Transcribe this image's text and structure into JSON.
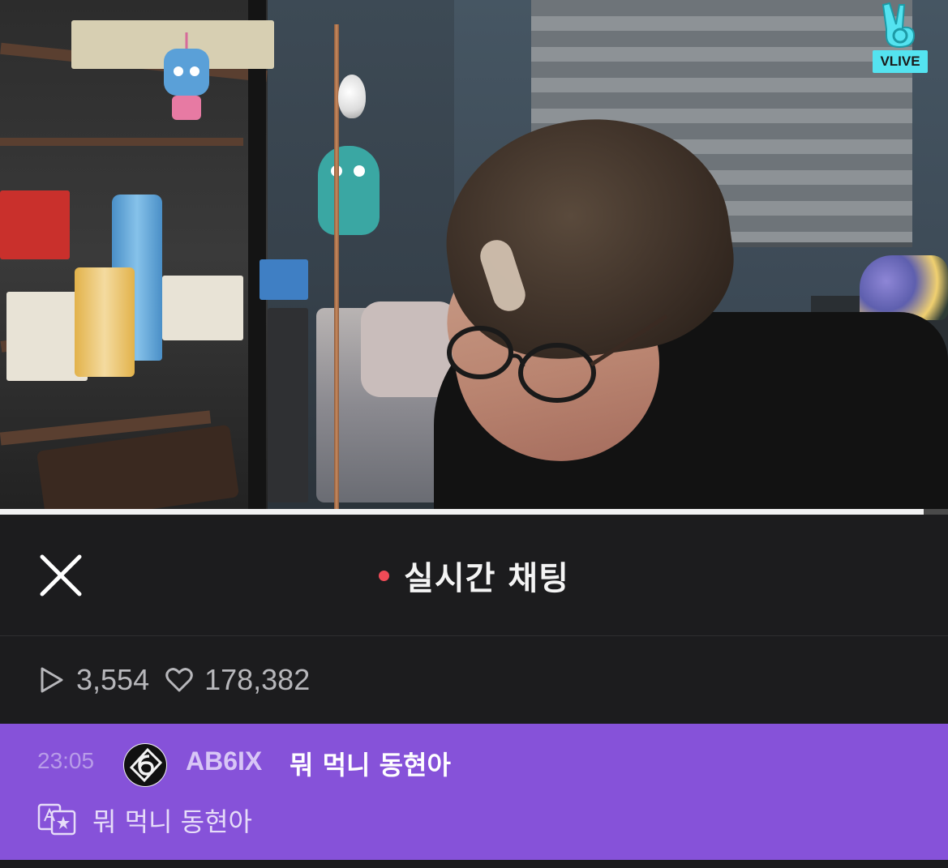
{
  "video": {
    "logo_text": "VLIVE",
    "progress": 0.974
  },
  "chat_header": {
    "title": "실시간 채팅",
    "live_indicator_color": "#ef4b57"
  },
  "stats": {
    "plays": "3,554",
    "likes": "178,382",
    "play_icon": "play-icon",
    "like_icon": "heart-icon"
  },
  "message": {
    "time": "23:05",
    "author": "AB6IX",
    "text": "뭐 먹니 동현아",
    "translation": "뭐 먹니 동현아",
    "background_color": "#8652d9"
  }
}
